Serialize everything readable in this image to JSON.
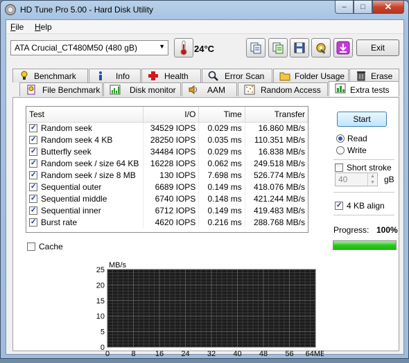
{
  "window": {
    "title": "HD Tune Pro 5.00 - Hard Disk Utility",
    "min": "–",
    "max": "□",
    "close": "✕"
  },
  "menu": {
    "file": {
      "u": "F",
      "rest": "ile"
    },
    "help": {
      "u": "H",
      "rest": "elp"
    }
  },
  "toolbar": {
    "drive": "ATA   Crucial_CT480M50 (480 gB)",
    "temperature": "24°C",
    "exit": "Exit"
  },
  "tabs_back": [
    {
      "label": "Benchmark",
      "icon": "benchmark-icon"
    },
    {
      "label": "Info",
      "icon": "info-icon"
    },
    {
      "label": "Health",
      "icon": "health-icon"
    },
    {
      "label": "Error Scan",
      "icon": "error-scan-icon"
    },
    {
      "label": "Folder Usage",
      "icon": "folder-icon"
    },
    {
      "label": "Erase",
      "icon": "erase-icon"
    }
  ],
  "tabs_front": [
    {
      "label": "File Benchmark",
      "icon": "file-benchmark-icon"
    },
    {
      "label": "Disk monitor",
      "icon": "disk-monitor-icon"
    },
    {
      "label": "AAM",
      "icon": "speaker-icon"
    },
    {
      "label": "Random Access",
      "icon": "random-access-icon"
    },
    {
      "label": "Extra tests",
      "icon": "extra-tests-icon",
      "active": true
    }
  ],
  "table": {
    "headers": {
      "test": "Test",
      "io": "I/O",
      "time": "Time",
      "transfer": "Transfer"
    },
    "rows": [
      {
        "test": "Random seek",
        "io": "34529 IOPS",
        "time": "0.029 ms",
        "transfer": "16.860 MB/s",
        "checked": true
      },
      {
        "test": "Random seek 4 KB",
        "io": "28250 IOPS",
        "time": "0.035 ms",
        "transfer": "110.351 MB/s",
        "checked": true
      },
      {
        "test": "Butterfly seek",
        "io": "34484 IOPS",
        "time": "0.029 ms",
        "transfer": "16.838 MB/s",
        "checked": true
      },
      {
        "test": "Random seek / size 64 KB",
        "io": "16228 IOPS",
        "time": "0.062 ms",
        "transfer": "249.518 MB/s",
        "checked": true
      },
      {
        "test": "Random seek / size 8 MB",
        "io": "130 IOPS",
        "time": "7.698 ms",
        "transfer": "526.774 MB/s",
        "checked": true
      },
      {
        "test": "Sequential outer",
        "io": "6689 IOPS",
        "time": "0.149 ms",
        "transfer": "418.076 MB/s",
        "checked": true
      },
      {
        "test": "Sequential middle",
        "io": "6740 IOPS",
        "time": "0.148 ms",
        "transfer": "421.244 MB/s",
        "checked": true
      },
      {
        "test": "Sequential inner",
        "io": "6712 IOPS",
        "time": "0.149 ms",
        "transfer": "419.483 MB/s",
        "checked": true
      },
      {
        "test": "Burst rate",
        "io": "4620 IOPS",
        "time": "0.216 ms",
        "transfer": "288.768 MB/s",
        "checked": true
      }
    ]
  },
  "options": {
    "start": "Start",
    "read": "Read",
    "write": "Write",
    "mode_selected": "Read",
    "short_stroke": "Short stroke",
    "short_stroke_checked": false,
    "stroke_value": "40",
    "stroke_unit": "gB",
    "align_4kb": "4 KB align",
    "align_4kb_checked": true,
    "progress_label": "Progress:",
    "progress_value": "100%",
    "progress_fraction": 1.0,
    "cache": "Cache",
    "cache_checked": false
  },
  "chart_data": {
    "type": "line",
    "ylabel": "MB/s",
    "ylim": [
      0,
      25
    ],
    "yticks": [
      0,
      5,
      10,
      15,
      20,
      25
    ],
    "xlim": [
      0,
      64
    ],
    "xticks": [
      "0",
      "8",
      "16",
      "24",
      "32",
      "40",
      "48",
      "56",
      "64MB"
    ],
    "series": [],
    "grid": true,
    "background": "#1c1c1c",
    "grid_color": "#5a5a5a"
  }
}
